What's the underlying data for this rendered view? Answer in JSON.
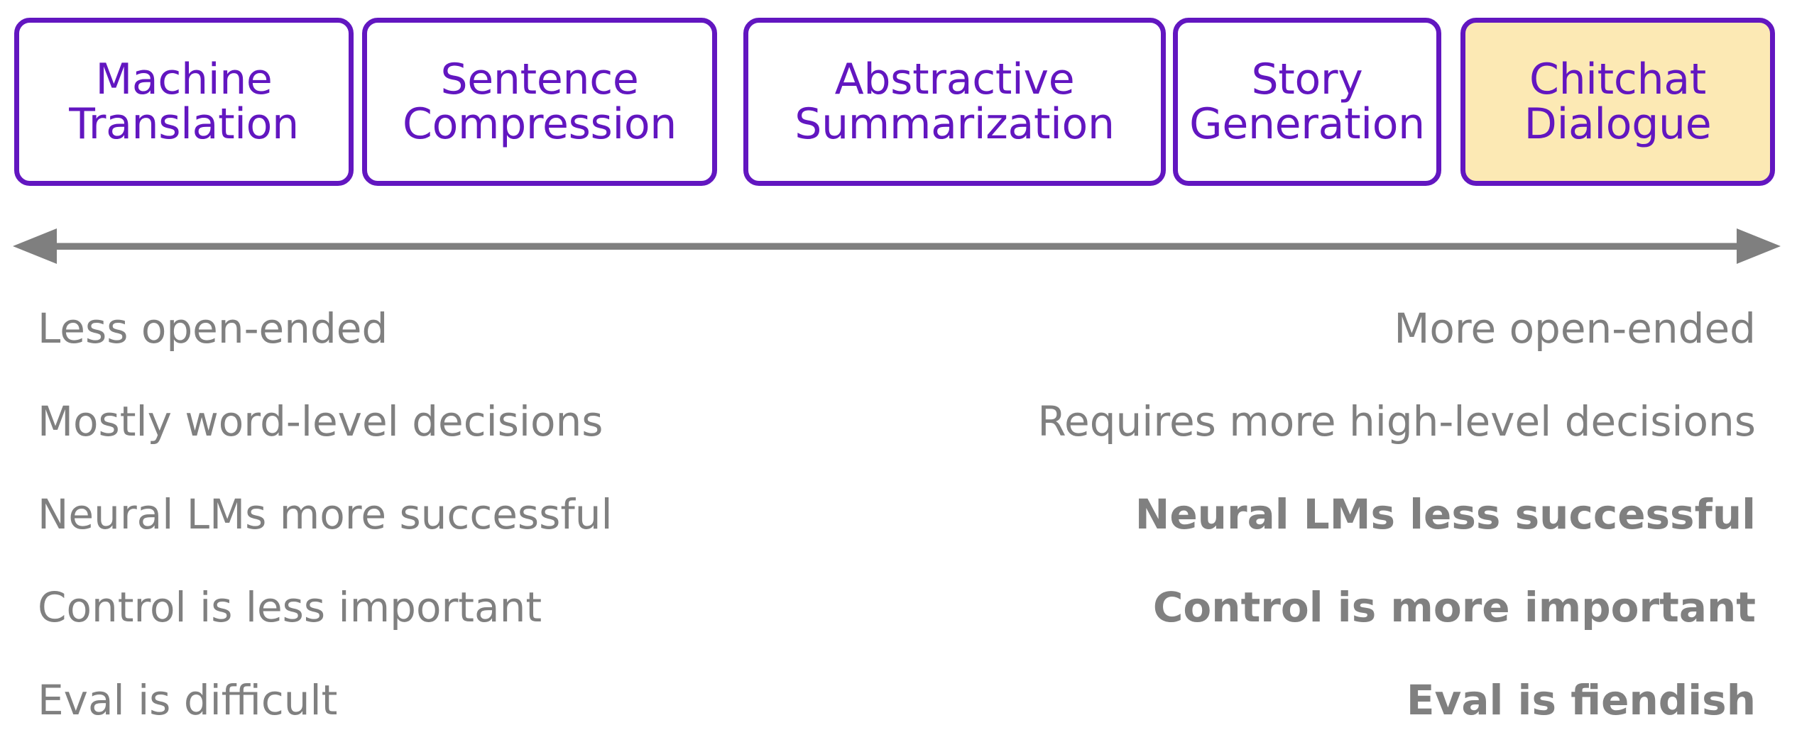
{
  "colors": {
    "accent_purple": "#6216C0",
    "highlight_yellow": "#FCE9B4",
    "text_gray": "#808080",
    "arrow_gray": "#7F7F7F",
    "background": "#FFFFFF"
  },
  "task_spectrum": {
    "boxes": [
      {
        "label": "Machine\nTranslation",
        "highlighted": false
      },
      {
        "label": "Sentence\nCompression",
        "highlighted": false
      },
      {
        "label": "Abstractive\nSummarization",
        "highlighted": false
      },
      {
        "label": "Story\nGeneration",
        "highlighted": false
      },
      {
        "label": "Chitchat\nDialogue",
        "highlighted": true
      }
    ]
  },
  "axis": {
    "icon": "double-headed-horizontal-arrow",
    "left_end": "Less open-ended",
    "right_end": "More open-ended"
  },
  "comparison": {
    "rows": [
      {
        "left": "Less open-ended",
        "right": "More open-ended",
        "left_bold": false,
        "right_bold": false
      },
      {
        "left": "Mostly word-level decisions",
        "right": "Requires more high-level decisions",
        "left_bold": false,
        "right_bold": false
      },
      {
        "left": "Neural LMs more successful",
        "right": "Neural LMs less successful",
        "left_bold": false,
        "right_bold": true
      },
      {
        "left": "Control is less important",
        "right": "Control is more important",
        "left_bold": false,
        "right_bold": true
      },
      {
        "left": "Eval is difficult",
        "right": "Eval is fiendish",
        "left_bold": false,
        "right_bold": true
      }
    ]
  }
}
